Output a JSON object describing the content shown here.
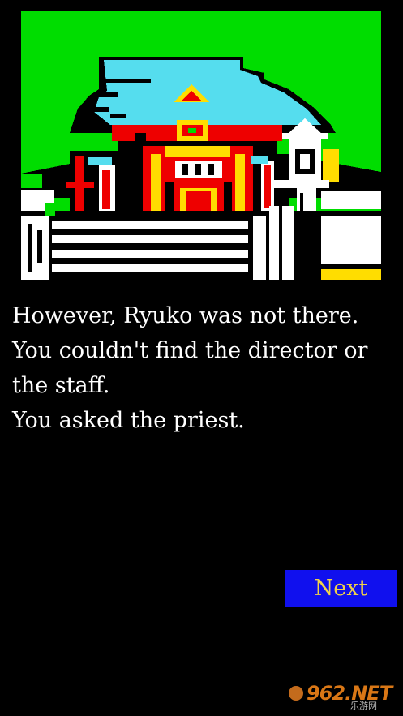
{
  "scene": {
    "subject": "shrine-illustration",
    "palette": {
      "grass": "#00dd00",
      "roof": "#55ddee",
      "shrine_red": "#ee0000",
      "gold": "#ffdd00",
      "wall": "#ffffff",
      "outline": "#000000"
    }
  },
  "narration": {
    "lines": [
      "However, Ryuko was not there.",
      "You couldn't find the director or",
      "the staff.",
      "You asked the priest."
    ]
  },
  "controls": {
    "next_label": "Next"
  },
  "watermark": {
    "text": "962.NET",
    "sub": "乐游网"
  },
  "colors": {
    "background": "#000000",
    "text": "#ffffff",
    "button_bg": "#1010ee",
    "button_text": "#f0d24a"
  }
}
